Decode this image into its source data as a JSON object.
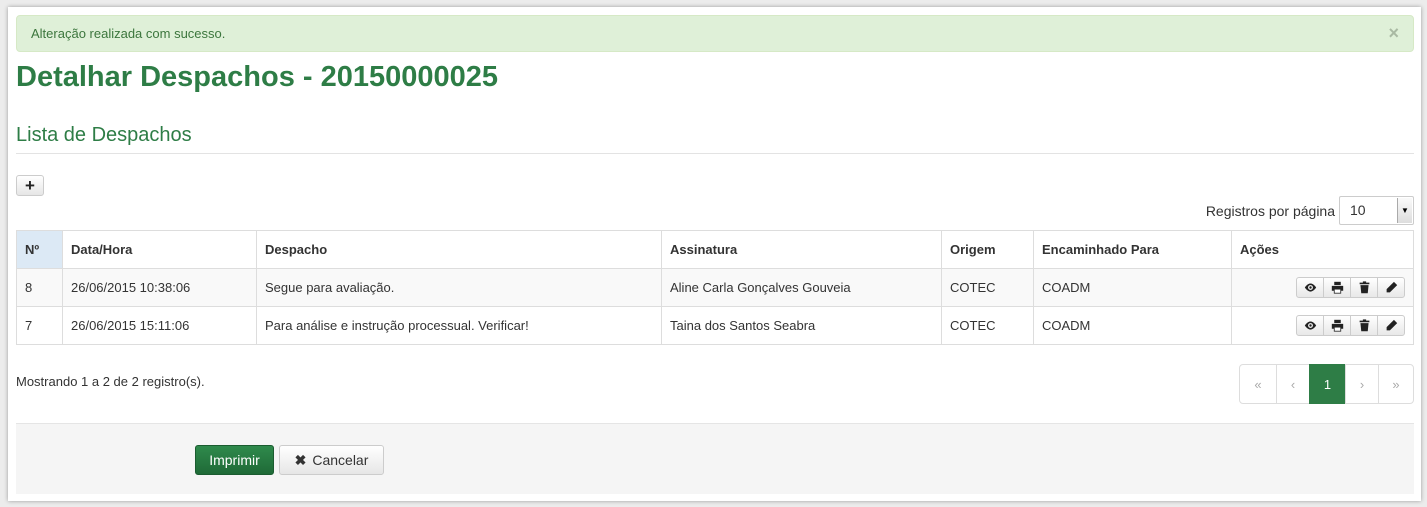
{
  "alert": {
    "message": "Alteração realizada com sucesso.",
    "close": "×"
  },
  "page_title": "Detalhar Despachos - 20150000025",
  "section_title": "Lista de Despachos",
  "add_button": {
    "icon": "plus-icon",
    "label": "+"
  },
  "per_page": {
    "label": "Registros por página",
    "value": "10",
    "arrow": "▼"
  },
  "table": {
    "headers": [
      "Nº",
      "Data/Hora",
      "Despacho",
      "Assinatura",
      "Origem",
      "Encaminhado Para",
      "Ações"
    ],
    "rows": [
      {
        "num": "8",
        "datetime": "26/06/2015 10:38:06",
        "despacho": "Segue para avaliação.",
        "assinatura": "Aline Carla Gonçalves Gouveia",
        "origem": "COTEC",
        "encaminhado": "COADM"
      },
      {
        "num": "7",
        "datetime": "26/06/2015 15:11:06",
        "despacho": "Para análise e instrução processual. Verificar!",
        "assinatura": "Taina dos Santos Seabra",
        "origem": "COTEC",
        "encaminhado": "COADM"
      }
    ],
    "row_actions": [
      "eye-icon",
      "print-icon",
      "trash-icon",
      "pencil-icon"
    ]
  },
  "summary": "Mostrando 1 a 2 de 2 registro(s).",
  "pagination": {
    "first": "«",
    "prev": "‹",
    "current": "1",
    "next": "›",
    "last": "»"
  },
  "buttons": {
    "print": "Imprimir",
    "cancel": "Cancelar",
    "cancel_icon": "✖"
  },
  "colors": {
    "brand_green": "#2e7d46",
    "alert_bg": "#dff0d8",
    "alert_text": "#3c763d",
    "sorted_header": "#dce9f5"
  }
}
